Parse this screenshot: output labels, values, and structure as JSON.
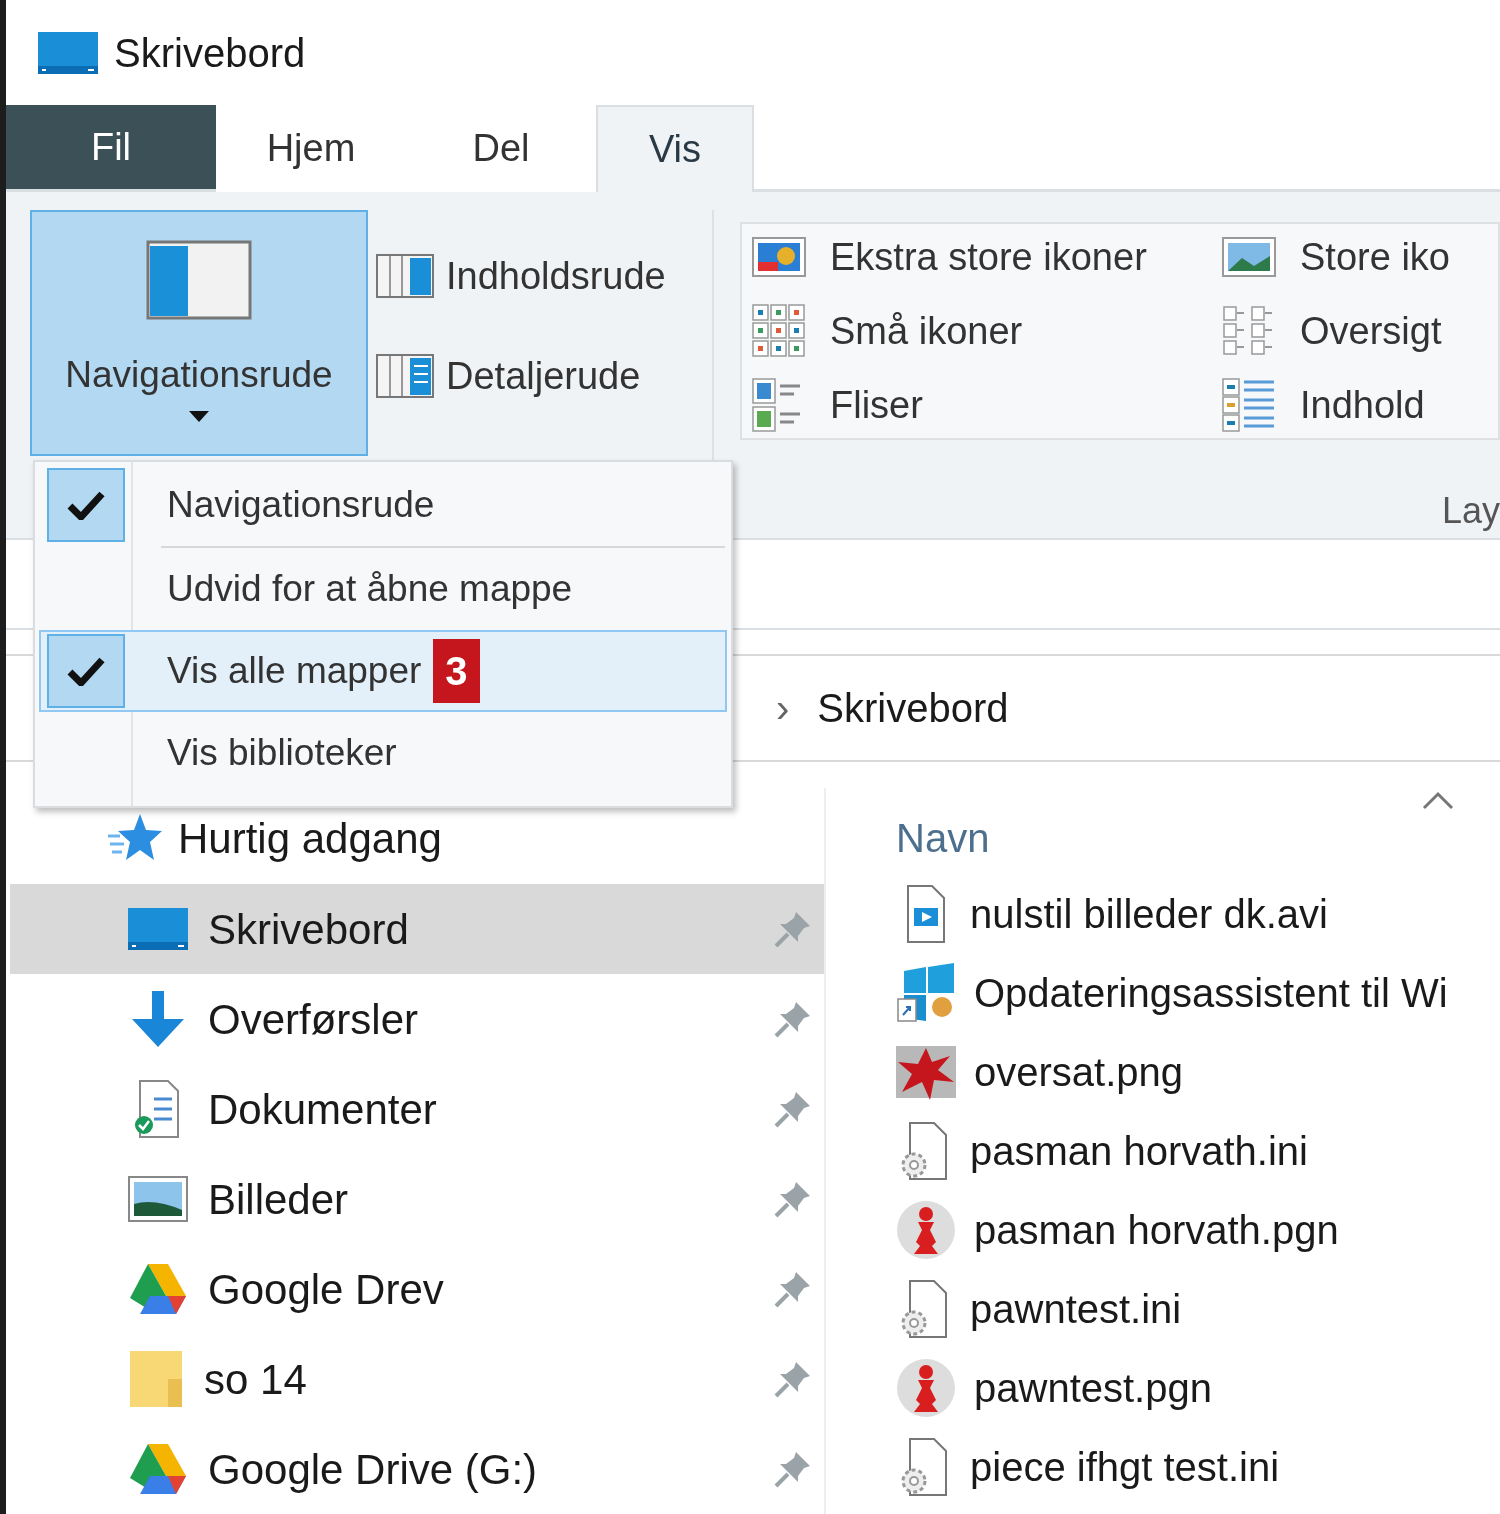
{
  "window": {
    "title": "Skrivebord"
  },
  "tabs": [
    {
      "label": "Fil",
      "kind": "file",
      "selected": false
    },
    {
      "label": "Hjem",
      "kind": "tab",
      "selected": false
    },
    {
      "label": "Del",
      "kind": "tab",
      "selected": false
    },
    {
      "label": "Vis",
      "kind": "tab",
      "selected": true
    }
  ],
  "ribbon": {
    "navigation_pane_button": {
      "label": "Navigationsrude",
      "expanded": true
    },
    "panes": [
      {
        "label": "Indholdsrude",
        "kind": "preview"
      },
      {
        "label": "Detaljerude",
        "kind": "details"
      }
    ],
    "layout": {
      "options": [
        {
          "label": "Ekstra store ikoner",
          "kind": "extra-large"
        },
        {
          "label": "Store iko",
          "kind": "large"
        },
        {
          "label": "Små ikoner",
          "kind": "small"
        },
        {
          "label": "Oversigt",
          "kind": "list"
        },
        {
          "label": "Fliser",
          "kind": "tiles"
        },
        {
          "label": "Indhold",
          "kind": "content"
        }
      ],
      "group_label": "Lay"
    }
  },
  "navigation_menu": {
    "items": [
      {
        "label": "Navigationsrude",
        "checked": true,
        "selected": false
      },
      {
        "label": "Udvid for at åbne mappe",
        "checked": false,
        "selected": false
      },
      {
        "label": "Vis alle mapper",
        "checked": true,
        "selected": true,
        "badge": "3"
      },
      {
        "label": "Vis biblioteker",
        "checked": false,
        "selected": false
      }
    ]
  },
  "address_bar": {
    "separator": "›",
    "location": "Skrivebord"
  },
  "navigation_pane": {
    "header": "Hurtig adgang",
    "items": [
      {
        "label": "Skrivebord",
        "kind": "desktop",
        "selected": true,
        "pinned": true
      },
      {
        "label": "Overførsler",
        "kind": "downloads",
        "selected": false,
        "pinned": true
      },
      {
        "label": "Dokumenter",
        "kind": "documents",
        "selected": false,
        "pinned": true
      },
      {
        "label": "Billeder",
        "kind": "pictures",
        "selected": false,
        "pinned": true
      },
      {
        "label": "Google Drev",
        "kind": "drive",
        "selected": false,
        "pinned": true
      },
      {
        "label": "so 14",
        "kind": "folder",
        "selected": false,
        "pinned": true
      },
      {
        "label": "Google Drive (G:)",
        "kind": "drive",
        "selected": false,
        "pinned": true
      }
    ]
  },
  "file_list": {
    "column": "Navn",
    "files": [
      {
        "name": "nulstil billeder dk.avi",
        "kind": "video"
      },
      {
        "name": "Opdateringsassistent til Wi",
        "kind": "app"
      },
      {
        "name": "oversat.png",
        "kind": "image"
      },
      {
        "name": "pasman horvath.ini",
        "kind": "settings"
      },
      {
        "name": "pasman horvath.pgn",
        "kind": "chess"
      },
      {
        "name": "pawntest.ini",
        "kind": "settings"
      },
      {
        "name": "pawntest.pgn",
        "kind": "chess"
      },
      {
        "name": "piece ifhgt test.ini",
        "kind": "settings"
      }
    ]
  }
}
